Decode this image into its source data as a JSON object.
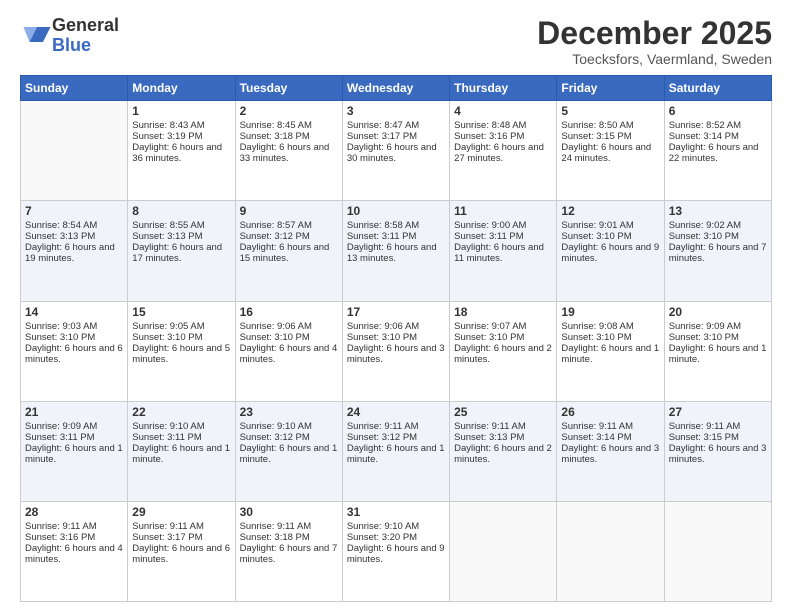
{
  "logo": {
    "line1": "General",
    "line2": "Blue"
  },
  "title": "December 2025",
  "subtitle": "Toecksfors, Vaermland, Sweden",
  "days": [
    "Sunday",
    "Monday",
    "Tuesday",
    "Wednesday",
    "Thursday",
    "Friday",
    "Saturday"
  ],
  "weeks": [
    [
      {
        "day": "",
        "sunrise": "",
        "sunset": "",
        "daylight": ""
      },
      {
        "day": "1",
        "sunrise": "Sunrise: 8:43 AM",
        "sunset": "Sunset: 3:19 PM",
        "daylight": "Daylight: 6 hours and 36 minutes."
      },
      {
        "day": "2",
        "sunrise": "Sunrise: 8:45 AM",
        "sunset": "Sunset: 3:18 PM",
        "daylight": "Daylight: 6 hours and 33 minutes."
      },
      {
        "day": "3",
        "sunrise": "Sunrise: 8:47 AM",
        "sunset": "Sunset: 3:17 PM",
        "daylight": "Daylight: 6 hours and 30 minutes."
      },
      {
        "day": "4",
        "sunrise": "Sunrise: 8:48 AM",
        "sunset": "Sunset: 3:16 PM",
        "daylight": "Daylight: 6 hours and 27 minutes."
      },
      {
        "day": "5",
        "sunrise": "Sunrise: 8:50 AM",
        "sunset": "Sunset: 3:15 PM",
        "daylight": "Daylight: 6 hours and 24 minutes."
      },
      {
        "day": "6",
        "sunrise": "Sunrise: 8:52 AM",
        "sunset": "Sunset: 3:14 PM",
        "daylight": "Daylight: 6 hours and 22 minutes."
      }
    ],
    [
      {
        "day": "7",
        "sunrise": "Sunrise: 8:54 AM",
        "sunset": "Sunset: 3:13 PM",
        "daylight": "Daylight: 6 hours and 19 minutes."
      },
      {
        "day": "8",
        "sunrise": "Sunrise: 8:55 AM",
        "sunset": "Sunset: 3:13 PM",
        "daylight": "Daylight: 6 hours and 17 minutes."
      },
      {
        "day": "9",
        "sunrise": "Sunrise: 8:57 AM",
        "sunset": "Sunset: 3:12 PM",
        "daylight": "Daylight: 6 hours and 15 minutes."
      },
      {
        "day": "10",
        "sunrise": "Sunrise: 8:58 AM",
        "sunset": "Sunset: 3:11 PM",
        "daylight": "Daylight: 6 hours and 13 minutes."
      },
      {
        "day": "11",
        "sunrise": "Sunrise: 9:00 AM",
        "sunset": "Sunset: 3:11 PM",
        "daylight": "Daylight: 6 hours and 11 minutes."
      },
      {
        "day": "12",
        "sunrise": "Sunrise: 9:01 AM",
        "sunset": "Sunset: 3:10 PM",
        "daylight": "Daylight: 6 hours and 9 minutes."
      },
      {
        "day": "13",
        "sunrise": "Sunrise: 9:02 AM",
        "sunset": "Sunset: 3:10 PM",
        "daylight": "Daylight: 6 hours and 7 minutes."
      }
    ],
    [
      {
        "day": "14",
        "sunrise": "Sunrise: 9:03 AM",
        "sunset": "Sunset: 3:10 PM",
        "daylight": "Daylight: 6 hours and 6 minutes."
      },
      {
        "day": "15",
        "sunrise": "Sunrise: 9:05 AM",
        "sunset": "Sunset: 3:10 PM",
        "daylight": "Daylight: 6 hours and 5 minutes."
      },
      {
        "day": "16",
        "sunrise": "Sunrise: 9:06 AM",
        "sunset": "Sunset: 3:10 PM",
        "daylight": "Daylight: 6 hours and 4 minutes."
      },
      {
        "day": "17",
        "sunrise": "Sunrise: 9:06 AM",
        "sunset": "Sunset: 3:10 PM",
        "daylight": "Daylight: 6 hours and 3 minutes."
      },
      {
        "day": "18",
        "sunrise": "Sunrise: 9:07 AM",
        "sunset": "Sunset: 3:10 PM",
        "daylight": "Daylight: 6 hours and 2 minutes."
      },
      {
        "day": "19",
        "sunrise": "Sunrise: 9:08 AM",
        "sunset": "Sunset: 3:10 PM",
        "daylight": "Daylight: 6 hours and 1 minute."
      },
      {
        "day": "20",
        "sunrise": "Sunrise: 9:09 AM",
        "sunset": "Sunset: 3:10 PM",
        "daylight": "Daylight: 6 hours and 1 minute."
      }
    ],
    [
      {
        "day": "21",
        "sunrise": "Sunrise: 9:09 AM",
        "sunset": "Sunset: 3:11 PM",
        "daylight": "Daylight: 6 hours and 1 minute."
      },
      {
        "day": "22",
        "sunrise": "Sunrise: 9:10 AM",
        "sunset": "Sunset: 3:11 PM",
        "daylight": "Daylight: 6 hours and 1 minute."
      },
      {
        "day": "23",
        "sunrise": "Sunrise: 9:10 AM",
        "sunset": "Sunset: 3:12 PM",
        "daylight": "Daylight: 6 hours and 1 minute."
      },
      {
        "day": "24",
        "sunrise": "Sunrise: 9:11 AM",
        "sunset": "Sunset: 3:12 PM",
        "daylight": "Daylight: 6 hours and 1 minute."
      },
      {
        "day": "25",
        "sunrise": "Sunrise: 9:11 AM",
        "sunset": "Sunset: 3:13 PM",
        "daylight": "Daylight: 6 hours and 2 minutes."
      },
      {
        "day": "26",
        "sunrise": "Sunrise: 9:11 AM",
        "sunset": "Sunset: 3:14 PM",
        "daylight": "Daylight: 6 hours and 3 minutes."
      },
      {
        "day": "27",
        "sunrise": "Sunrise: 9:11 AM",
        "sunset": "Sunset: 3:15 PM",
        "daylight": "Daylight: 6 hours and 3 minutes."
      }
    ],
    [
      {
        "day": "28",
        "sunrise": "Sunrise: 9:11 AM",
        "sunset": "Sunset: 3:16 PM",
        "daylight": "Daylight: 6 hours and 4 minutes."
      },
      {
        "day": "29",
        "sunrise": "Sunrise: 9:11 AM",
        "sunset": "Sunset: 3:17 PM",
        "daylight": "Daylight: 6 hours and 6 minutes."
      },
      {
        "day": "30",
        "sunrise": "Sunrise: 9:11 AM",
        "sunset": "Sunset: 3:18 PM",
        "daylight": "Daylight: 6 hours and 7 minutes."
      },
      {
        "day": "31",
        "sunrise": "Sunrise: 9:10 AM",
        "sunset": "Sunset: 3:20 PM",
        "daylight": "Daylight: 6 hours and 9 minutes."
      },
      {
        "day": "",
        "sunrise": "",
        "sunset": "",
        "daylight": ""
      },
      {
        "day": "",
        "sunrise": "",
        "sunset": "",
        "daylight": ""
      },
      {
        "day": "",
        "sunrise": "",
        "sunset": "",
        "daylight": ""
      }
    ]
  ]
}
